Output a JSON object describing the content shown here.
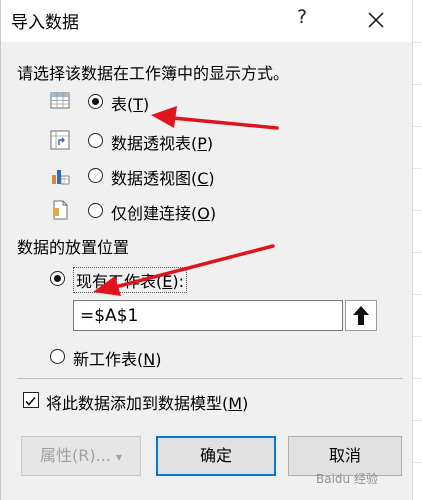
{
  "dialog": {
    "title": "导入数据",
    "help": "?",
    "prompt": "请选择该数据在工作簿中的显示方式。",
    "display_options": [
      {
        "pre": "表(",
        "key": "T",
        "post": ")",
        "icon": "table-icon",
        "selected": true
      },
      {
        "pre": "数据透视表(",
        "key": "P",
        "post": ")",
        "icon": "pivottable-icon",
        "selected": false
      },
      {
        "pre": "数据透视图(",
        "key": "C",
        "post": ")",
        "icon": "pivotchart-icon",
        "selected": false
      },
      {
        "pre": "仅创建连接(",
        "key": "O",
        "post": ")",
        "icon": "connection-only-icon",
        "selected": false
      }
    ],
    "placement_heading": "数据的放置位置",
    "existing_sheet": {
      "pre": "现有工作表(",
      "key": "E",
      "post": "):",
      "selected": true
    },
    "range_value": "=$A$1",
    "new_sheet": {
      "pre": "新工作表(",
      "key": "N",
      "post": ")",
      "selected": false
    },
    "add_to_model": {
      "pre": "将此数据添加到数据模型(",
      "key": "M",
      "post": ")",
      "checked": true
    },
    "buttons": {
      "properties": "属性(R)...",
      "properties_caret": "▾",
      "ok": "确定",
      "cancel": "取消"
    }
  },
  "colors": {
    "annotation_arrow": "#e0141e",
    "default_button_border": "#0078d7"
  },
  "watermark": "Baidu 经验"
}
